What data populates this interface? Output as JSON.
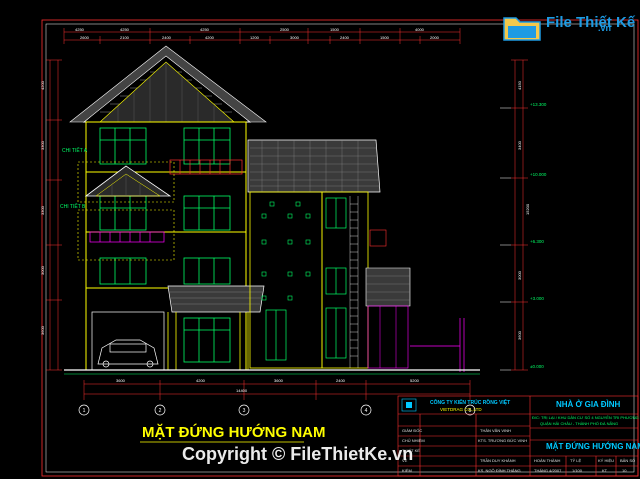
{
  "logo": {
    "text": "File Thiết Kế",
    "tld": ".vn",
    "icon": "folder-icon",
    "color": "#1e9be3"
  },
  "drawing": {
    "title": "MẶT ĐỨNG HƯỚNG NAM",
    "callouts": [
      "CHI TIẾT A",
      "CHI TIẾT B"
    ],
    "grid_markers": [
      "1",
      "2",
      "3",
      "4",
      "5"
    ],
    "levels": [
      "+13.300",
      "+10.000",
      "+6.300",
      "+3.000",
      "±0.000"
    ]
  },
  "title_block": {
    "company": "CÔNG TY KIẾN TRÚC RỒNG VIỆT",
    "company_short": "VIETDRAG CO.,LTD",
    "project": "NHÀ Ở GIA ĐÌNH",
    "address_1": "Đ/C: TRỊ LẠI / KHU DÂN CƯ SỐ 4 NGUYỄN TRI PHƯƠNG",
    "address_2": "QUẬN HẢI CHÂU - THÀNH PHỐ ĐÀ NẴNG",
    "sheet_title": "MẶT ĐỨNG HƯỚNG NAM",
    "rows": [
      "GIÁM ĐỐC",
      "CHỦ NHIỆM",
      "THIẾT KẾ",
      "VẼ",
      "KIỂM"
    ],
    "names": [
      "THÂN VĂN VINH",
      "KTS. TRƯƠNG ĐỨC VINH",
      "TRẦN DUY KHÁNH",
      "KS. NGÔ ĐÌNH THẮNG"
    ],
    "meta_labels": [
      "HOÀN THÀNH",
      "TỶ LỆ",
      "KÝ HIỆU",
      "BẢN SỐ"
    ],
    "meta_values": [
      "THÁNG 4/2007",
      "1/100",
      "KT",
      "10"
    ]
  },
  "watermark": {
    "text": "Copyright © FileThietKe.vn"
  },
  "colors": {
    "background": "#000000",
    "wall": "#ffff00",
    "roof": "#ffffff",
    "window": "#00ff66",
    "dimension": "#ff3030",
    "accent": "#ff00ff"
  }
}
